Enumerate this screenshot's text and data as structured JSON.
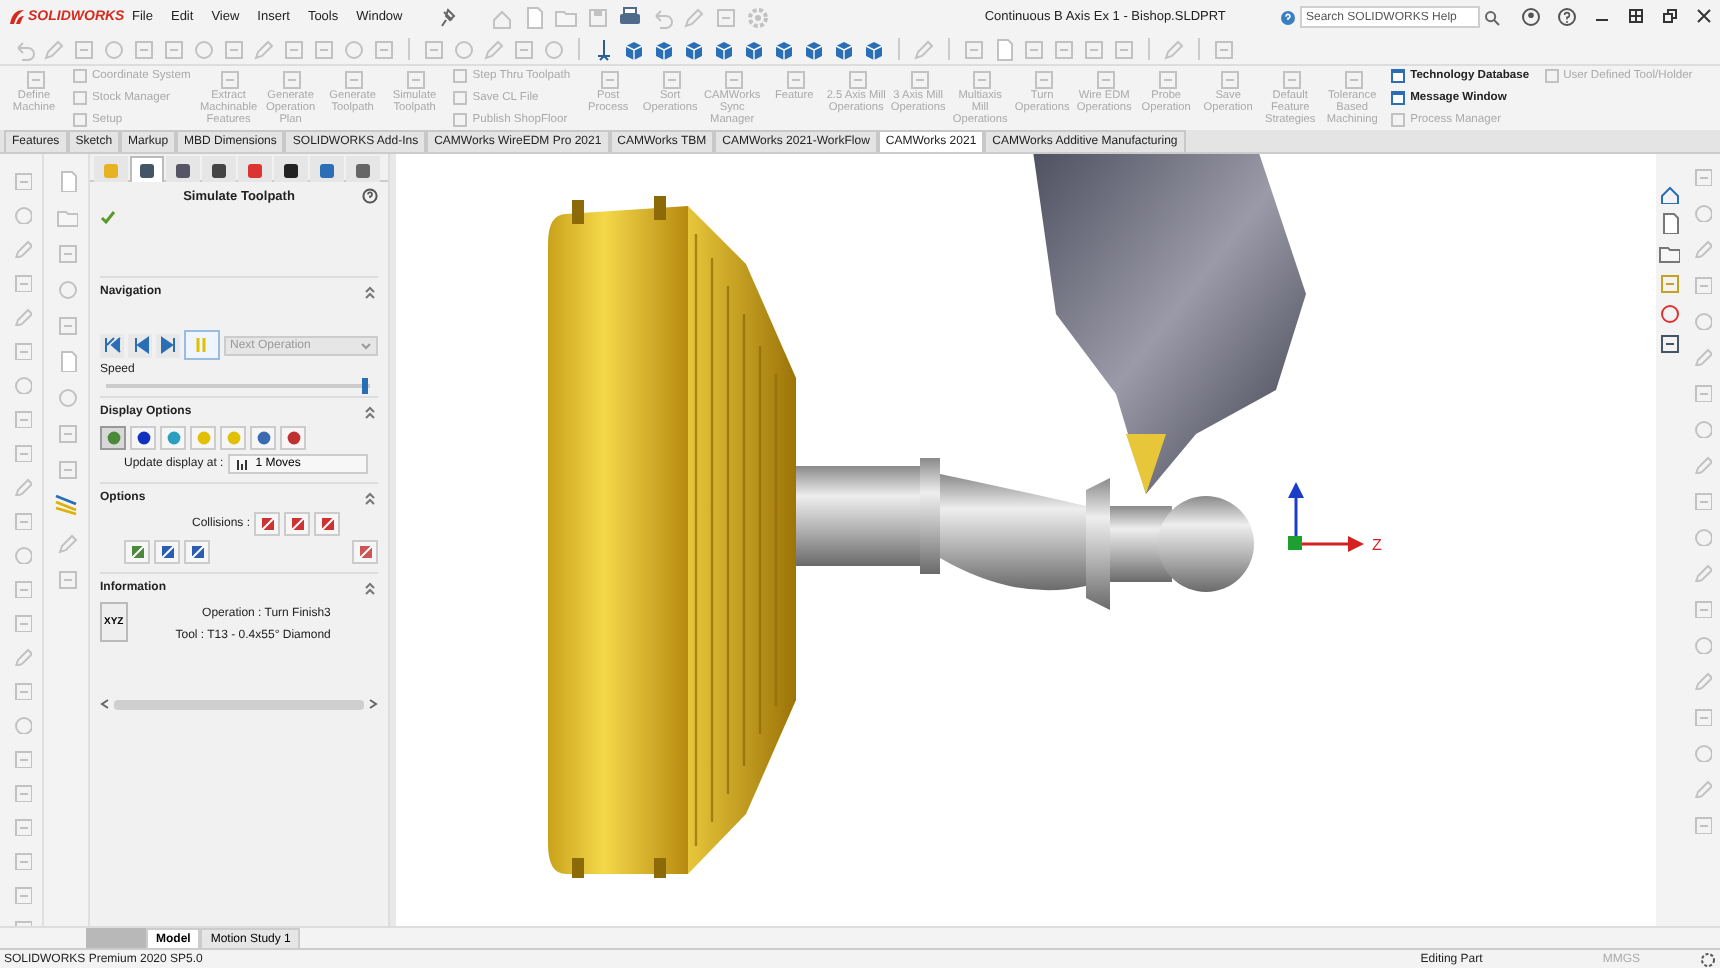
{
  "window": {
    "app": "SOLIDWORKS",
    "title": "Continuous B Axis Ex 1 - Bishop.SLDPRT"
  },
  "menu": [
    "File",
    "Edit",
    "View",
    "Insert",
    "Tools",
    "Window"
  ],
  "search": {
    "placeholder": "Search SOLIDWORKS Help"
  },
  "command_manager": {
    "columns": [
      {
        "items": [
          {
            "label": "Define Machine",
            "disabled": true
          }
        ]
      },
      {
        "items": [
          {
            "label": "Coordinate System",
            "disabled": true
          },
          {
            "label": "Stock Manager",
            "disabled": true
          },
          {
            "label": "Setup",
            "disabled": true
          }
        ]
      },
      {
        "items": [
          {
            "label": "Extract Machinable Features",
            "disabled": true
          }
        ]
      },
      {
        "items": [
          {
            "label": "Generate Operation Plan",
            "disabled": true
          }
        ]
      },
      {
        "items": [
          {
            "label": "Generate Toolpath",
            "disabled": true
          }
        ]
      },
      {
        "items": [
          {
            "label": "Simulate Toolpath",
            "disabled": true
          }
        ]
      },
      {
        "items": [
          {
            "label": "Step Thru Toolpath",
            "disabled": true
          },
          {
            "label": "Save CL File",
            "disabled": true
          },
          {
            "label": "Publish ShopFloor",
            "disabled": true
          }
        ]
      },
      {
        "items": [
          {
            "label": "Post Process",
            "disabled": true
          }
        ]
      },
      {
        "items": [
          {
            "label": "Sort Operations",
            "disabled": true
          }
        ]
      },
      {
        "items": [
          {
            "label": "CAMWorks Sync Manager",
            "disabled": true
          }
        ]
      },
      {
        "items": [
          {
            "label": "Feature",
            "disabled": true
          }
        ]
      },
      {
        "items": [
          {
            "label": "2.5 Axis Mill Operations",
            "disabled": true
          }
        ]
      },
      {
        "items": [
          {
            "label": "3 Axis Mill Operations",
            "disabled": true
          }
        ]
      },
      {
        "items": [
          {
            "label": "Multiaxis Mill Operations",
            "disabled": true
          }
        ]
      },
      {
        "items": [
          {
            "label": "Turn Operations",
            "disabled": true
          }
        ]
      },
      {
        "items": [
          {
            "label": "Wire EDM Operations",
            "disabled": true
          }
        ]
      },
      {
        "items": [
          {
            "label": "Probe Operation",
            "disabled": true
          }
        ]
      },
      {
        "items": [
          {
            "label": "Save Operation",
            "disabled": true
          }
        ]
      },
      {
        "items": [
          {
            "label": "Default Feature Strategies",
            "disabled": true
          }
        ]
      },
      {
        "items": [
          {
            "label": "Tolerance Based Machining",
            "disabled": true
          }
        ]
      },
      {
        "items": [
          {
            "label": "Technology Database",
            "disabled": false
          },
          {
            "label": "Message Window",
            "disabled": false
          },
          {
            "label": "Process Manager",
            "disabled": true
          }
        ]
      },
      {
        "items": [
          {
            "label": "User Defined Tool/Holder",
            "disabled": true
          }
        ]
      }
    ]
  },
  "command_tabs": [
    {
      "label": "Features",
      "selected": false
    },
    {
      "label": "Sketch",
      "selected": false
    },
    {
      "label": "Markup",
      "selected": false
    },
    {
      "label": "MBD Dimensions",
      "selected": false
    },
    {
      "label": "SOLIDWORKS Add-Ins",
      "selected": false
    },
    {
      "label": "CAMWorks WireEDM Pro 2021",
      "selected": false
    },
    {
      "label": "CAMWorks TBM",
      "selected": false
    },
    {
      "label": "CAMWorks 2021-WorkFlow",
      "selected": false
    },
    {
      "label": "CAMWorks 2021",
      "selected": true
    },
    {
      "label": "CAMWorks Additive Manufacturing",
      "selected": false
    }
  ],
  "property_manager": {
    "tabs": [
      {
        "selected": false
      },
      {
        "selected": true
      },
      {
        "selected": false
      },
      {
        "selected": false
      },
      {
        "selected": false
      },
      {
        "selected": false
      },
      {
        "selected": false
      },
      {
        "selected": false
      }
    ],
    "title": "Simulate Toolpath",
    "navigation": {
      "title": "Navigation",
      "buttons": [
        {
          "selected": false
        },
        {
          "selected": false
        },
        {
          "selected": false
        },
        {
          "selected": true
        }
      ],
      "dropdown": {
        "value": "Next Operation",
        "disabled": true
      },
      "speed": {
        "label": "Speed",
        "level": 0.98
      }
    },
    "display_options": {
      "title": "Display Options",
      "modes": [
        {
          "selected": true
        },
        {
          "selected": false
        },
        {
          "selected": false
        },
        {
          "selected": false
        },
        {
          "selected": false
        },
        {
          "selected": false
        },
        {
          "selected": false
        }
      ],
      "update_label": "Update display at :",
      "update_value": "1 Moves"
    },
    "options": {
      "title": "Options",
      "collisions_label": "Collisions :"
    },
    "information": {
      "title": "Information",
      "xyz_button": "XYZ",
      "operation": "Operation : Turn Finish3",
      "tool": "Tool : T13 - 0.4x55° Diamond"
    }
  },
  "viewport": {
    "axis_label": "Z"
  },
  "bottom_tabs": [
    {
      "label": "Model",
      "selected": true
    },
    {
      "label": "Motion Study 1",
      "selected": false
    }
  ],
  "status_bar": {
    "product": "SOLIDWORKS Premium 2020 SP5.0",
    "mode": "Editing Part",
    "units": "MMGS"
  }
}
